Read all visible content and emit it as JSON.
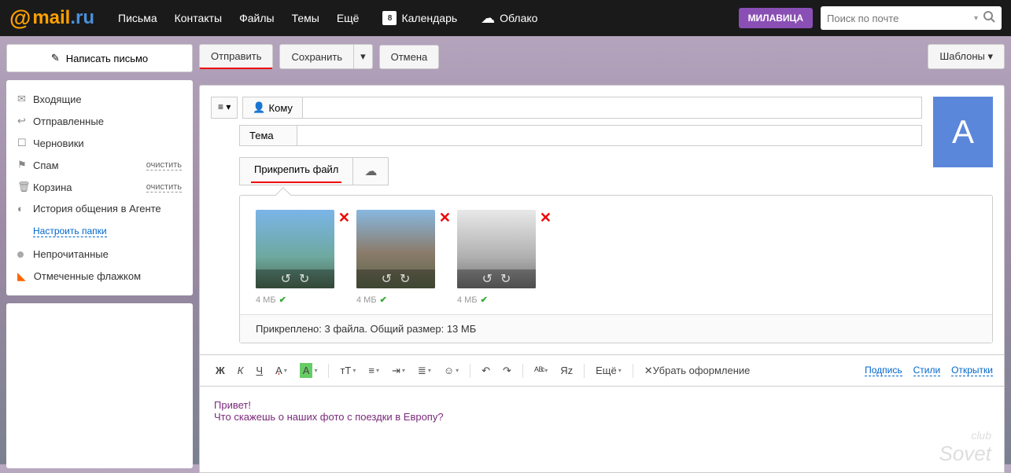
{
  "header": {
    "logo_at": "@",
    "logo_main": "mail",
    "logo_dot": ".ru",
    "nav": [
      "Письма",
      "Контакты",
      "Файлы",
      "Темы",
      "Ещё"
    ],
    "calendar_day": "8",
    "calendar": "Календарь",
    "cloud": "Облако",
    "user": "МИЛАВИЦА",
    "search_placeholder": "Поиск по почте"
  },
  "sidebar": {
    "compose": "Написать письмо",
    "folders": [
      {
        "label": "Входящие"
      },
      {
        "label": "Отправленные"
      },
      {
        "label": "Черновики"
      },
      {
        "label": "Спам",
        "clear": "очистить"
      },
      {
        "label": "Корзина",
        "clear": "очистить"
      },
      {
        "label": "История общения в Агенте"
      }
    ],
    "settings": "Настроить папки",
    "filters": {
      "unread": "Непрочитанные",
      "flagged": "Отмеченные флажком"
    }
  },
  "toolbar": {
    "send": "Отправить",
    "save": "Сохранить",
    "cancel": "Отмена",
    "templates": "Шаблоны"
  },
  "compose": {
    "to_label": "Кому",
    "subject_label": "Тема",
    "attach": "Прикрепить файл",
    "avatar_letter": "А",
    "attachments": [
      {
        "size": "4 МБ"
      },
      {
        "size": "4 МБ"
      },
      {
        "size": "4 МБ"
      }
    ],
    "summary": "Прикреплено: 3 файла. Общий размер: 13 МБ"
  },
  "editor": {
    "more": "Ещё",
    "remove_format": "Убрать оформление",
    "links": [
      "Подпись",
      "Стили",
      "Открытки"
    ]
  },
  "body": {
    "line1": "Привет!",
    "line2": "Что скажешь о наших фото с поездки в Европу?"
  },
  "watermark": {
    "top": "club",
    "bottom": "Sovet"
  }
}
